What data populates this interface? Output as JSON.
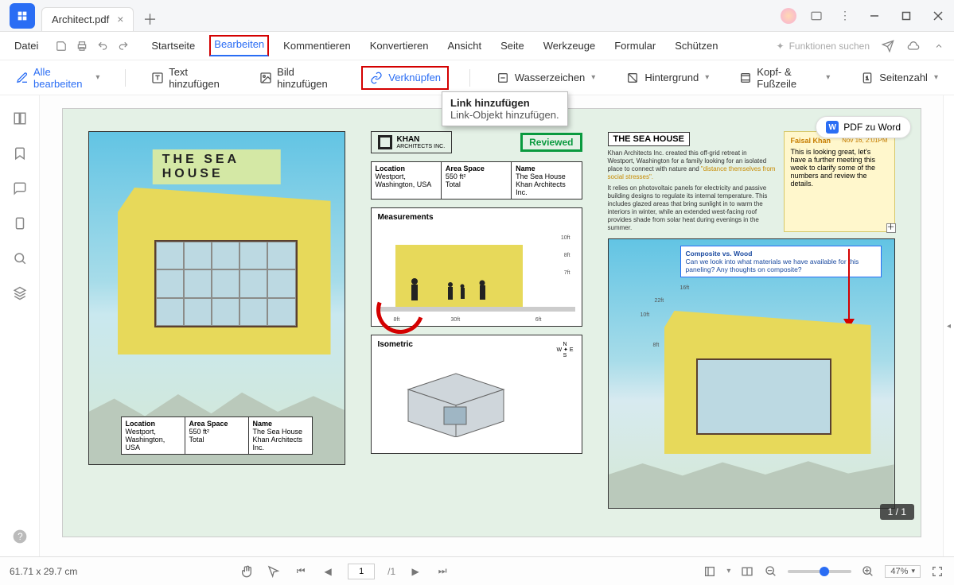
{
  "titlebar": {
    "tab_name": "Architect.pdf"
  },
  "menubar": {
    "file": "Datei",
    "tabs": [
      "Startseite",
      "Bearbeiten",
      "Kommentieren",
      "Konvertieren",
      "Ansicht",
      "Seite",
      "Werkzeuge",
      "Formular",
      "Schützen"
    ],
    "active_tab_index": 1,
    "search_placeholder": "Funktionen suchen"
  },
  "toolbar": {
    "edit_all": "Alle bearbeiten",
    "add_text": "Text hinzufügen",
    "add_image": "Bild hinzufügen",
    "link": "Verknüpfen",
    "watermark": "Wasserzeichen",
    "background": "Hintergrund",
    "header_footer": "Kopf- & Fußzeile",
    "page_number": "Seitenzahl"
  },
  "tooltip": {
    "title": "Link hinzufügen",
    "desc": "Link-Objekt hinzufügen."
  },
  "pdf_to_word": "PDF zu Word",
  "page_badge": "1 / 1",
  "document": {
    "main_title": "THE SEA HOUSE",
    "brand_line1": "KHAN",
    "brand_line2": "ARCHITECTS INC.",
    "reviewed": "Reviewed",
    "info": {
      "location_h": "Location",
      "location_v": "Westport,\nWashington, USA",
      "area_h": "Area Space",
      "area_v": "550 ft²\nTotal",
      "name_h": "Name",
      "name_v": "The Sea House\nKhan Architects Inc."
    },
    "measurements_title": "Measurements",
    "isometric_title": "Isometric",
    "compass": {
      "n": "N",
      "s": "S",
      "e": "E",
      "w": "W"
    },
    "dims": {
      "d30": "30ft",
      "d10": "10ft",
      "d8": "8ft",
      "d7": "7ft",
      "d6": "6ft",
      "d16": "16ft",
      "d22": "22ft"
    },
    "col3_title": "THE SEA HOUSE",
    "col3_desc": "Khan Architects Inc. created this off-grid retreat in Westport, Washington for a family looking for an isolated place to connect with nature and ",
    "col3_desc_hl": "\"distance themselves from social stresses\".",
    "col3_desc2": "It relies on photovoltaic panels for electricity and passive building designs to regulate its internal temperature. This includes glazed areas that bring sunlight in to warm the interiors in winter, while an extended west-facing roof provides shade from solar heat during evenings in the summer.",
    "sticky": {
      "author": "Faisal Khan",
      "date": "Nov 16, 2:01PM",
      "body": "This is looking great, let's have a further meeting this week to clarify some of the numbers and review the details."
    },
    "callout": {
      "title": "Composite vs. Wood",
      "body": "Can we look into what materials we have available for this paneling? Any thoughts on composite?"
    }
  },
  "statusbar": {
    "page_size": "61.71 x 29.7 cm",
    "current_page": "1",
    "total_pages": "/1",
    "zoom": "47%"
  }
}
